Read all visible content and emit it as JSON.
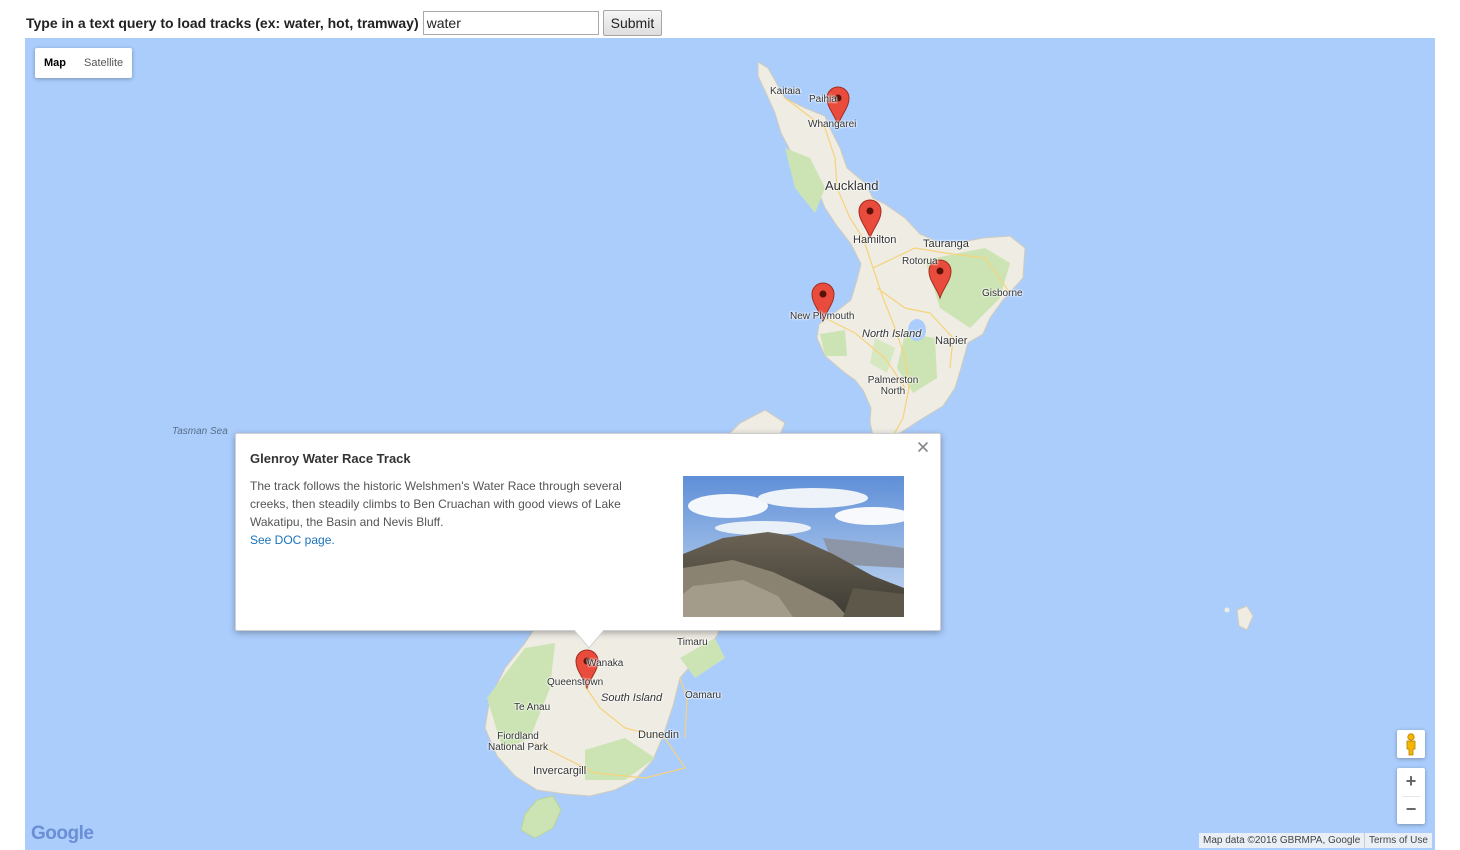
{
  "query": {
    "label": "Type in a text query to load tracks (ex: water, hot, tramway)",
    "value": "water",
    "submit_label": "Submit"
  },
  "map": {
    "map_types": [
      "Map",
      "Satellite"
    ],
    "selected_map_type": "Map",
    "water_color": "#abcdfc",
    "land_color": "#eeece3",
    "forest_color": "#cce4b4",
    "marker_color": "#e94b3c",
    "labels": {
      "kaitaia": "Kaitaia",
      "paihia": "Paihia",
      "whangarei": "Whangarei",
      "auckland": "Auckland",
      "hamilton": "Hamilton",
      "tauranga": "Tauranga",
      "rotorua": "Rotorua",
      "gisborne": "Gisborne",
      "new_plymouth": "New Plymouth",
      "north_island": "North Island",
      "napier": "Napier",
      "palmerston_north": "Palmerston North",
      "tasman_sea": "Tasman Sea",
      "timaru": "Timaru",
      "wanaka": "Wanaka",
      "queenstown": "Queenstown",
      "south_island": "South Island",
      "oamaru": "Oamaru",
      "te_anau": "Te Anau",
      "fiordland": "Fiordland National Park",
      "dunedin": "Dunedin",
      "invercargill": "Invercargill"
    },
    "markers": [
      {
        "name": "Whangarei track"
      },
      {
        "name": "Hamilton track"
      },
      {
        "name": "Rotorua track"
      },
      {
        "name": "New Plymouth track"
      },
      {
        "name": "Queenstown track"
      }
    ],
    "attribution": "Map data ©2016 GBRMPA, Google",
    "terms": "Terms of Use",
    "logo_text": "Google"
  },
  "popup": {
    "title": "Glenroy Water Race Track",
    "description": "The track follows the historic Welshmen's Water Race through several creeks, then steadily climbs to Ben Cruachan with good views of Lake Wakatipu, the Basin and Nevis Bluff.",
    "link_label": "See DOC page."
  },
  "icons": {
    "close": "close-icon",
    "pegman": "pegman-icon",
    "zoom_in": "zoom-in-icon",
    "zoom_out": "zoom-out-icon"
  }
}
